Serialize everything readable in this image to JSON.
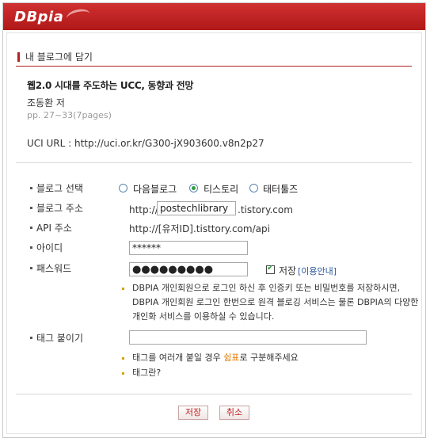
{
  "header": {
    "logo": "DBpia"
  },
  "section_title": "내 블로그에 담기",
  "paper": {
    "title": "웹2.0 시대를 주도하는 UCC, 동향과 전망",
    "author": "조동환 저",
    "pages": "pp. 27~33(7pages)",
    "uci": "UCI URL : http://uci.or.kr/G300-jX903600.v8n2p27"
  },
  "form": {
    "blog_select_label": "블로그 선택",
    "blog_options": [
      "다음블로그",
      "티스토리",
      "태터툴즈"
    ],
    "selected_option": "티스토리",
    "blog_address_label": "블로그 주소",
    "blog_address_prefix": "http://",
    "blog_address_value": "postechlibrary",
    "blog_address_suffix": ".tistory.com",
    "api_label": "API 주소",
    "api_value": "http://[유저ID].tisttory.com/api",
    "id_label": "아이디",
    "id_value": "******",
    "password_label": "패스워드",
    "password_value": "●●●●●●●●●",
    "save_label": "저장",
    "usage_guide": "[이용안내]",
    "notice_line1": "DBPIA 개인회원으로 로그인 하신 후 인증키 또는 비밀번호를 저장하시면,",
    "notice_line2": "DBPIA 개인회원 로그인 한번으로 원격 블로깅 서비스는 물론 DBPIA의 다양한",
    "notice_line3": "개인화 서비스를 이용하실 수 있습니다.",
    "tag_label": "태그 붙이기",
    "tag_value": "",
    "tag_hint_before": "태그를 여러개 붙일 경우 ",
    "tag_hint_accent": "쉼표",
    "tag_hint_after": "로 구분해주세요",
    "tag_what": "태그란?"
  },
  "buttons": {
    "save": "저장",
    "cancel": "취소"
  },
  "colors": {
    "brand_red": "#b32222",
    "check_green": "#2f9e3f",
    "link_blue": "#2a5a9e",
    "accent_orange": "#e07a00"
  }
}
